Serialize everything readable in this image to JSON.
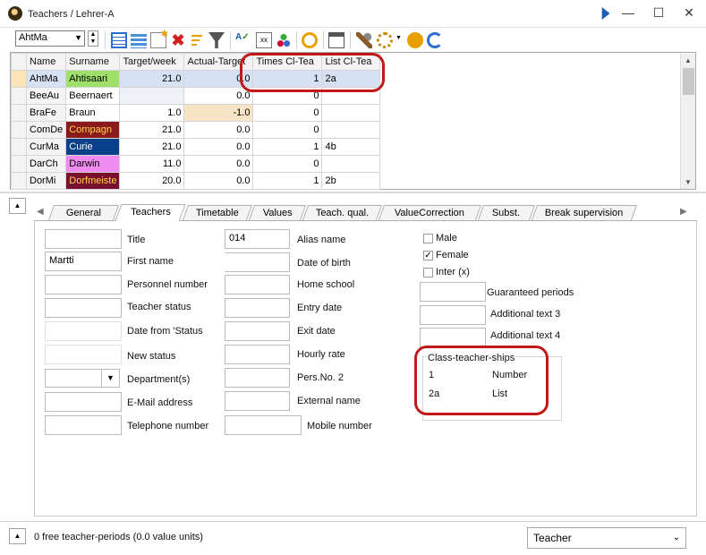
{
  "window": {
    "title": "Teachers / Lehrer-A"
  },
  "toolbar": {
    "selector_value": "AhtMa"
  },
  "grid": {
    "columns": [
      "Name",
      "Surname",
      "Target/week",
      "Actual-Target",
      "Times Cl-Tea",
      "List Cl-Tea"
    ],
    "rows": [
      {
        "name": "AhtMa",
        "surname": "Ahtisaari",
        "target": "21.0",
        "actual": "0.0",
        "times": "1",
        "list": "2a",
        "color": "#9ee06a",
        "text": "#000"
      },
      {
        "name": "BeeAu",
        "surname": "Beernaert",
        "target": "",
        "actual": "0.0",
        "times": "0",
        "list": "",
        "color": "#ffffff",
        "text": "#000"
      },
      {
        "name": "BraFe",
        "surname": "Braun",
        "target": "1.0",
        "actual": "-1.0",
        "times": "0",
        "list": "",
        "color": "#ffffff",
        "text": "#000"
      },
      {
        "name": "ComDe",
        "surname": "Compagn",
        "target": "21.0",
        "actual": "0.0",
        "times": "0",
        "list": "",
        "color": "#8b1a1a",
        "text": "#ffd54a"
      },
      {
        "name": "CurMa",
        "surname": "Curie",
        "target": "21.0",
        "actual": "0.0",
        "times": "1",
        "list": "4b",
        "color": "#0a3f8a",
        "text": "#ffffff"
      },
      {
        "name": "DarCh",
        "surname": "Darwin",
        "target": "11.0",
        "actual": "0.0",
        "times": "0",
        "list": "",
        "color": "#f08cf0",
        "text": "#000"
      },
      {
        "name": "DorMi",
        "surname": "Dorfmeiste",
        "target": "20.0",
        "actual": "0.0",
        "times": "1",
        "list": "2b",
        "color": "#7a1030",
        "text": "#ffd54a"
      }
    ]
  },
  "tabs": [
    "General",
    "Teachers",
    "Timetable",
    "Values",
    "Teach. qual.",
    "ValueCorrection",
    "Subst.",
    "Break supervision"
  ],
  "form": {
    "col1": {
      "title_value": "",
      "first_name_value": "Martti",
      "labels": [
        "Title",
        "First name",
        "Personnel number",
        "Teacher status",
        "Date from 'Status",
        "New status",
        "Department(s)",
        "E-Mail address",
        "Telephone number"
      ]
    },
    "col2": {
      "alias_value": "014",
      "labels": [
        "Alias name",
        "Date of birth",
        "Home school",
        "Entry date",
        "Exit date",
        "Hourly rate",
        "Pers.No. 2",
        "External name",
        "Mobile number"
      ]
    },
    "col3": {
      "checkboxes": [
        "Male",
        "Female",
        "Inter (x)"
      ],
      "labels": [
        "Guaranteed periods",
        "Additional text 3",
        "Additional text 4"
      ]
    },
    "ctships": {
      "heading": "Class-teacher-ships",
      "rows": [
        {
          "value": "1",
          "label": "Number"
        },
        {
          "value": "2a",
          "label": "List"
        }
      ]
    }
  },
  "status": {
    "text": "0 free teacher-periods (0.0 value units)",
    "dropdown": "Teacher"
  }
}
